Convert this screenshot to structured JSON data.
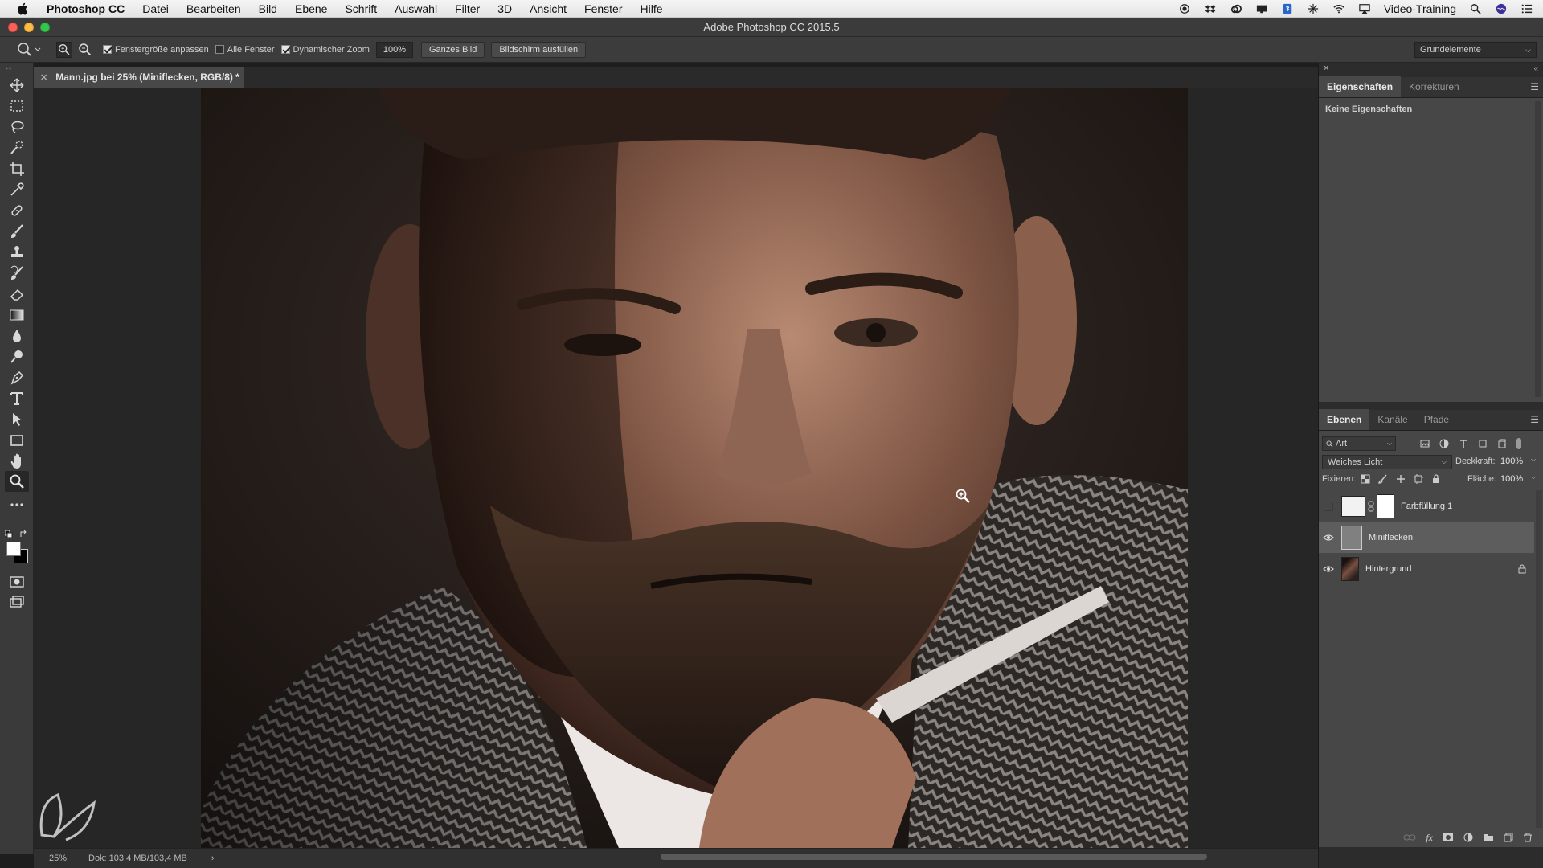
{
  "menubar": {
    "app_name": "Photoshop CC",
    "items": [
      "Datei",
      "Bearbeiten",
      "Bild",
      "Ebene",
      "Schrift",
      "Auswahl",
      "Filter",
      "3D",
      "Ansicht",
      "Fenster",
      "Hilfe"
    ],
    "right_label": "Video-Training"
  },
  "window": {
    "title": "Adobe Photoshop CC 2015.5"
  },
  "options": {
    "resize_windows": "Fenstergröße anpassen",
    "resize_windows_checked": true,
    "all_windows": "Alle Fenster",
    "all_windows_checked": false,
    "scrubby_zoom": "Dynamischer Zoom",
    "scrubby_zoom_checked": true,
    "zoom_value": "100%",
    "fit_screen": "Ganzes Bild",
    "fill_screen": "Bildschirm ausfüllen",
    "workspace": "Grundelemente"
  },
  "document": {
    "tab_title": "Mann.jpg bei 25% (Miniflecken, RGB/8) *"
  },
  "status": {
    "zoom": "25%",
    "doc_size": "Dok: 103,4 MB/103,4 MB"
  },
  "properties": {
    "tabs": [
      "Eigenschaften",
      "Korrekturen"
    ],
    "message": "Keine Eigenschaften"
  },
  "layers": {
    "tabs": [
      "Ebenen",
      "Kanäle",
      "Pfade"
    ],
    "filter_kind": "Art",
    "blend_mode": "Weiches Licht",
    "opacity_label": "Deckkraft:",
    "opacity_value": "100%",
    "lock_label": "Fixieren:",
    "fill_label": "Fläche:",
    "fill_value": "100%",
    "items": [
      {
        "name": "Farbfüllung 1",
        "visible": false,
        "selected": false,
        "locked": false
      },
      {
        "name": "Miniflecken",
        "visible": true,
        "selected": true,
        "locked": false
      },
      {
        "name": "Hintergrund",
        "visible": true,
        "selected": false,
        "locked": true
      }
    ]
  },
  "colors": {
    "ui_panel": "#474747",
    "ui_dark": "#262626",
    "selected_row": "#5d5d5d"
  }
}
